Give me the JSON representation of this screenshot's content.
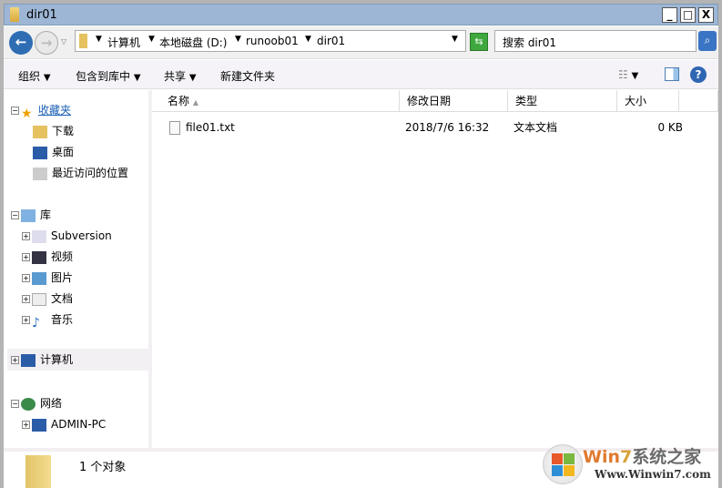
{
  "window": {
    "title": "dir01",
    "minimize": "_",
    "maximize": "□",
    "close": "X"
  },
  "address": {
    "segments": [
      "计算机",
      "本地磁盘 (D:)",
      "runoob01",
      "dir01"
    ],
    "search_placeholder": "搜索 dir01"
  },
  "toolbar": {
    "organize": "组织",
    "include": "包含到库中",
    "share": "共享",
    "new_folder": "新建文件夹",
    "help": "?"
  },
  "sidebar": {
    "favorites": {
      "label": "收藏夹",
      "items": [
        "下载",
        "桌面",
        "最近访问的位置"
      ]
    },
    "libraries": {
      "label": "库",
      "items": [
        "Subversion",
        "视频",
        "图片",
        "文档",
        "音乐"
      ]
    },
    "computer": {
      "label": "计算机"
    },
    "network": {
      "label": "网络",
      "items": [
        "ADMIN-PC"
      ]
    }
  },
  "columns": [
    "名称",
    "修改日期",
    "类型",
    "大小"
  ],
  "files": [
    {
      "name": "file01.txt",
      "modified": "2018/7/6 16:32",
      "type": "文本文档",
      "size": "0 KB"
    }
  ],
  "status": {
    "count": "1 个对象"
  },
  "watermark": {
    "brand_a": "Win",
    "brand_b": "7",
    "brand_c": "系统之家",
    "url": "Www.Winwin7.com"
  }
}
